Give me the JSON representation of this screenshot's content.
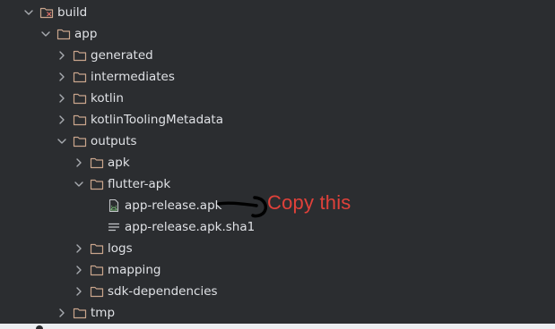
{
  "tree": {
    "items": [
      {
        "label": "build",
        "level": 0,
        "expanded": true,
        "icon": "folder-excluded-icon"
      },
      {
        "label": "app",
        "level": 1,
        "expanded": true,
        "icon": "folder-icon"
      },
      {
        "label": "generated",
        "level": 2,
        "expanded": false,
        "icon": "folder-icon"
      },
      {
        "label": "intermediates",
        "level": 2,
        "expanded": false,
        "icon": "folder-icon"
      },
      {
        "label": "kotlin",
        "level": 2,
        "expanded": false,
        "icon": "folder-icon"
      },
      {
        "label": "kotlinToolingMetadata",
        "level": 2,
        "expanded": false,
        "icon": "folder-icon"
      },
      {
        "label": "outputs",
        "level": 2,
        "expanded": true,
        "icon": "folder-icon"
      },
      {
        "label": "apk",
        "level": 3,
        "expanded": false,
        "icon": "folder-icon"
      },
      {
        "label": "flutter-apk",
        "level": 3,
        "expanded": true,
        "icon": "folder-icon"
      },
      {
        "label": "app-release.apk",
        "level": 4,
        "expanded": null,
        "icon": "android-apk-file-icon"
      },
      {
        "label": "app-release.apk.sha1",
        "level": 4,
        "expanded": null,
        "icon": "text-file-icon"
      },
      {
        "label": "logs",
        "level": 3,
        "expanded": false,
        "icon": "folder-icon"
      },
      {
        "label": "mapping",
        "level": 3,
        "expanded": false,
        "icon": "folder-icon"
      },
      {
        "label": "sdk-dependencies",
        "level": 3,
        "expanded": false,
        "icon": "folder-icon"
      },
      {
        "label": "tmp",
        "level": 2,
        "expanded": false,
        "icon": "folder-icon"
      }
    ]
  },
  "annotation": {
    "text": "Copy this",
    "color": "#e0413a"
  },
  "colors": {
    "background": "#2b2d30",
    "text": "#dfe1e5",
    "folder_outline": "#c9a58c",
    "chevron": "#a8abb0",
    "apk_icon": "#7cc07a",
    "text_file_icon": "#c4c6ca"
  }
}
